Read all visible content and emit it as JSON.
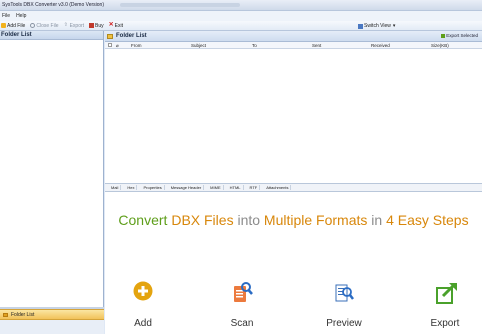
{
  "window": {
    "title": "SysTools DBX Converter v3.0 (Demo Version)"
  },
  "menu": {
    "items": [
      "File",
      "Help"
    ]
  },
  "toolbar": {
    "add_file": "Add File",
    "close_file": "Close File",
    "export": "Export",
    "buy": "Buy",
    "exit": "Exit",
    "switch_view": "Switch View"
  },
  "left_panel": {
    "title": "Folder List",
    "tab_label": "Folder List"
  },
  "right_panel": {
    "title": "Folder List",
    "export_selected": "Export Selected",
    "columns": [
      "From",
      "Subject",
      "To",
      "Sent",
      "Received",
      "Size(KB)"
    ],
    "tabs": [
      "Mail",
      "Hex",
      "Properties",
      "Message Header",
      "MIME",
      "HTML",
      "RTF",
      "Attachments"
    ]
  },
  "banner": {
    "parts": [
      {
        "text": "Convert ",
        "color": "green"
      },
      {
        "text": "DBX Files ",
        "color": "orange"
      },
      {
        "text": "into ",
        "color": "grey"
      },
      {
        "text": "Multiple Formats ",
        "color": "orange"
      },
      {
        "text": "in ",
        "color": "grey"
      },
      {
        "text": "4 Easy Steps",
        "color": "orange"
      }
    ],
    "steps": [
      {
        "label": "Add",
        "icon": "add-icon"
      },
      {
        "label": "Scan",
        "icon": "scan-icon"
      },
      {
        "label": "Preview",
        "icon": "preview-icon"
      },
      {
        "label": "Export",
        "icon": "export-icon"
      }
    ]
  },
  "colors": {
    "green": "#5e9e1a",
    "orange": "#d8870b",
    "grey": "#8c8c8c",
    "tab_gold": "#f2c25a"
  }
}
